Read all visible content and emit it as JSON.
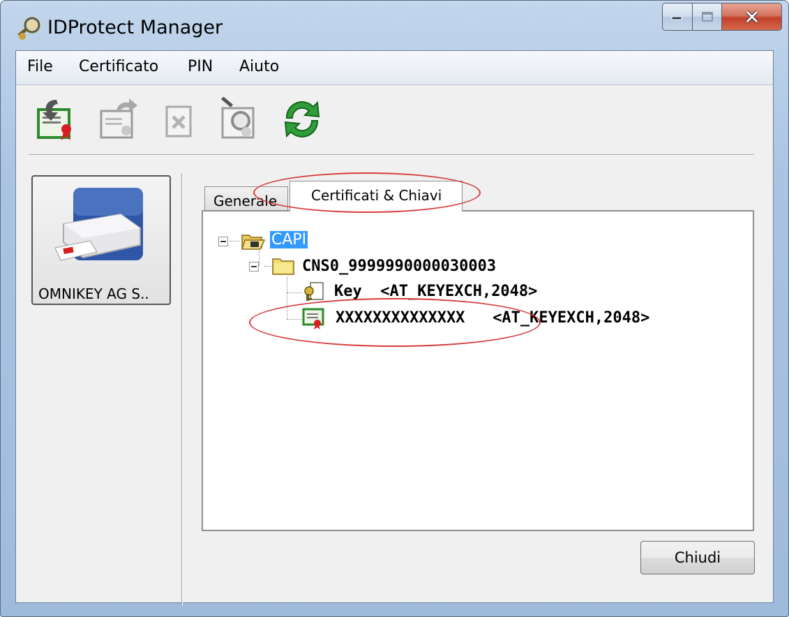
{
  "window": {
    "title": "IDProtect Manager"
  },
  "menu": {
    "items": [
      "File",
      "Certificato",
      "PIN",
      "Aiuto"
    ]
  },
  "toolbar": {
    "buttons": [
      {
        "icon": "import-certificate-icon"
      },
      {
        "icon": "export-certificate-icon"
      },
      {
        "icon": "delete-certificate-icon"
      },
      {
        "icon": "view-certificate-icon"
      },
      {
        "icon": "refresh-icon"
      }
    ]
  },
  "device": {
    "label": "OMNIKEY AG S.."
  },
  "tabs": [
    {
      "label": "Generale",
      "active": false
    },
    {
      "label": "Certificati & Chiavi",
      "active": true
    }
  ],
  "tree": {
    "root": "CAPI",
    "container": "CNS0_9999990000030003",
    "key": {
      "name": "Key",
      "detail": "<AT_KEYEXCH,2048>"
    },
    "certificate": {
      "name": "XXXXXXXXXXXXXX",
      "detail": "<AT_KEYEXCH,2048>"
    }
  },
  "close_button": "Chiudi",
  "colors": {
    "selection": "#3399ff",
    "annotation": "#d83a3a",
    "close_caption": "#c2412a"
  }
}
